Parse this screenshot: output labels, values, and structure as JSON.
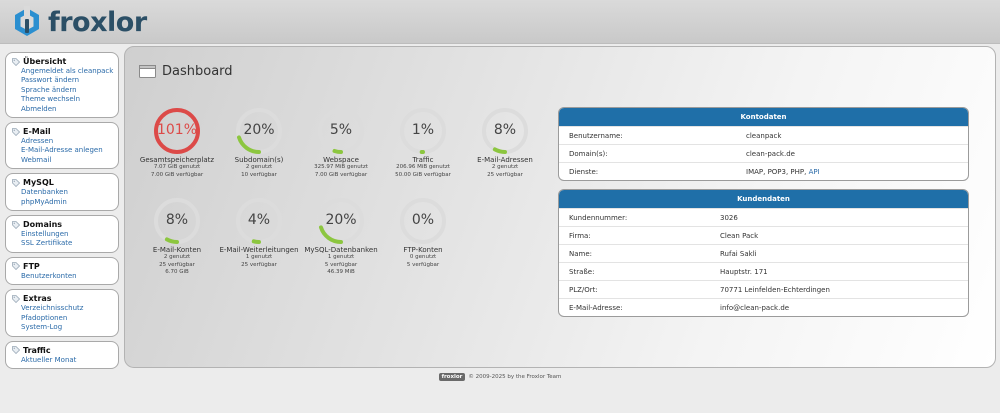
{
  "app": {
    "name": "froxlor",
    "brand_color": "#2b4f66"
  },
  "nav": [
    {
      "title": "Übersicht",
      "links": [
        "Angemeldet als cleanpack",
        "Passwort ändern",
        "Sprache ändern",
        "Theme wechseln",
        "Abmelden"
      ]
    },
    {
      "title": "E-Mail",
      "links": [
        "Adressen",
        "E-Mail-Adresse anlegen",
        "Webmail"
      ]
    },
    {
      "title": "MySQL",
      "links": [
        "Datenbanken",
        "phpMyAdmin"
      ]
    },
    {
      "title": "Domains",
      "links": [
        "Einstellungen",
        "SSL Zertifikate"
      ]
    },
    {
      "title": "FTP",
      "links": [
        "Benutzerkonten"
      ]
    },
    {
      "title": "Extras",
      "links": [
        "Verzeichnisschutz",
        "Pfadoptionen",
        "System-Log"
      ]
    },
    {
      "title": "Traffic",
      "links": [
        "Aktueller Monat"
      ]
    }
  ],
  "page": {
    "title": "Dashboard"
  },
  "gauges": [
    {
      "percent": 101,
      "label": "101%",
      "title": "Gesamtspeicherplatz",
      "lines": [
        "7.07 GiB genutzt",
        "7.00 GiB verfügbar"
      ],
      "color": "#dc4a48"
    },
    {
      "percent": 20,
      "label": "20%",
      "title": "Subdomain(s)",
      "lines": [
        "2 genutzt",
        "10 verfügbar"
      ],
      "color": "#8cc63f"
    },
    {
      "percent": 5,
      "label": "5%",
      "title": "Webspace",
      "lines": [
        "325.97 MiB genutzt",
        "7.00 GiB verfügbar"
      ],
      "color": "#8cc63f"
    },
    {
      "percent": 1,
      "label": "1%",
      "title": "Traffic",
      "lines": [
        "206.96 MiB genutzt",
        "50.00 GiB verfügbar"
      ],
      "color": "#8cc63f"
    },
    {
      "percent": 8,
      "label": "8%",
      "title": "E-Mail-Adressen",
      "lines": [
        "2 genutzt",
        "25 verfügbar"
      ],
      "color": "#8cc63f"
    },
    {
      "percent": 8,
      "label": "8%",
      "title": "E-Mail-Konten",
      "lines": [
        "2 genutzt",
        "25 verfügbar",
        "6.70 GiB"
      ],
      "color": "#8cc63f"
    },
    {
      "percent": 4,
      "label": "4%",
      "title": "E-Mail-Weiterleitungen",
      "lines": [
        "1 genutzt",
        "25 verfügbar"
      ],
      "color": "#8cc63f"
    },
    {
      "percent": 20,
      "label": "20%",
      "title": "MySQL-Datenbanken",
      "lines": [
        "1 genutzt",
        "5 verfügbar",
        "46.39 MiB"
      ],
      "color": "#8cc63f"
    },
    {
      "percent": 0,
      "label": "0%",
      "title": "FTP-Konten",
      "lines": [
        "0 genutzt",
        "5 verfügbar"
      ],
      "color": "#8cc63f"
    }
  ],
  "kontodaten": {
    "title": "Kontodaten",
    "rows": [
      {
        "key": "Benutzername:",
        "value": "cleanpack"
      },
      {
        "key": "Domain(s):",
        "value": "clean-pack.de"
      },
      {
        "key": "Dienste:",
        "value": "IMAP, POP3, PHP, ",
        "link": "API"
      }
    ]
  },
  "kundendaten": {
    "title": "Kundendaten",
    "rows": [
      {
        "key": "Kundennummer:",
        "value": "3026"
      },
      {
        "key": "Firma:",
        "value": "Clean Pack"
      },
      {
        "key": "Name:",
        "value": "Rufai Sakli"
      },
      {
        "key": "Straße:",
        "value": "Hauptstr. 171"
      },
      {
        "key": "PLZ/Ort:",
        "value": "70771 Leinfelden-Echterdingen"
      },
      {
        "key": "E-Mail-Adresse:",
        "value": "info@clean-pack.de"
      }
    ]
  },
  "footer": {
    "badge": "froxlor",
    "text": "© 2009-2025 by the Froxlor Team"
  }
}
